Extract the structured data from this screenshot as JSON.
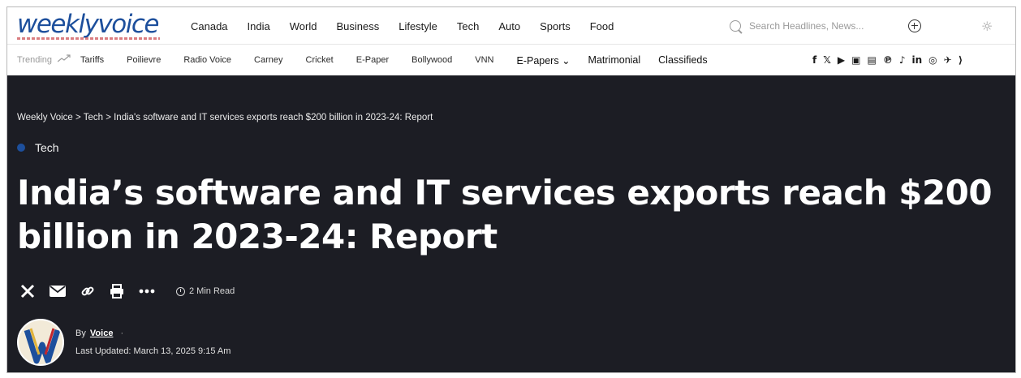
{
  "logo": {
    "text": "weeklyvoice"
  },
  "nav": {
    "items": [
      "Canada",
      "India",
      "World",
      "Business",
      "Lifestyle",
      "Tech",
      "Auto",
      "Sports",
      "Food"
    ]
  },
  "search": {
    "placeholder": "Search Headlines, News..."
  },
  "trending": {
    "label": "Trending",
    "items": [
      "Tariffs",
      "Poilievre",
      "Radio Voice",
      "Carney",
      "Cricket",
      "E-Paper",
      "Bollywood",
      "VNN"
    ],
    "strong_items": [
      "E-Papers ⌄",
      "Matrimonial",
      "Classifieds"
    ]
  },
  "socials": [
    "f",
    "𝕏",
    "▶",
    "▣",
    "▤",
    "℗",
    "♪",
    "in",
    "◎",
    "✈",
    "⟩"
  ],
  "article": {
    "breadcrumb": "Weekly Voice > Tech > India's software and IT services exports reach $200 billion in 2023-24: Report",
    "category": "Tech",
    "headline": "India’s software and IT services exports reach $200 billion in 2023-24: Report",
    "read_time": "2 Min Read",
    "byline_prefix": "By",
    "author": "Voice",
    "byline_sep": "·",
    "last_updated": "Last Updated: March 13, 2025 9:15 Am"
  },
  "colors": {
    "brand": "#1d4f9c",
    "hero_bg": "#1c1d24"
  }
}
